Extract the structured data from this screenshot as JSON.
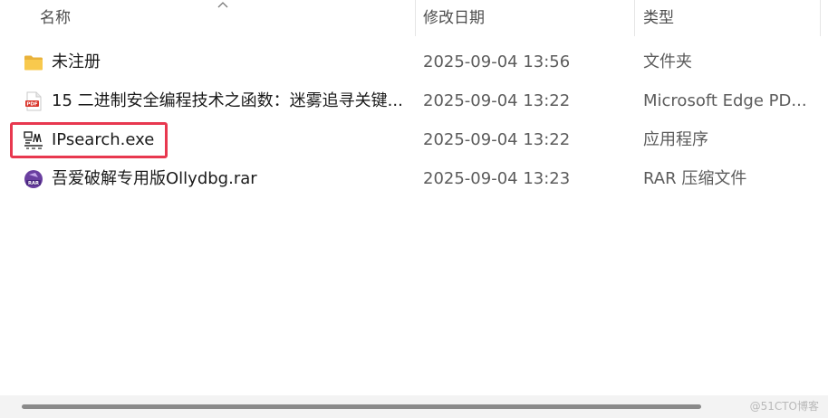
{
  "header": {
    "name_label": "名称",
    "date_label": "修改日期",
    "type_label": "类型"
  },
  "files": [
    {
      "name": "未注册",
      "date": "2025-09-04 13:56",
      "type": "文件夹",
      "icon": "folder-icon"
    },
    {
      "name": "15 二进制安全编程技术之函数：迷雾追寻关键...",
      "date": "2025-09-04 13:22",
      "type": "Microsoft Edge PD...",
      "icon": "pdf-file-icon"
    },
    {
      "name": "IPsearch.exe",
      "date": "2025-09-04 13:22",
      "type": "应用程序",
      "icon": "executable-icon"
    },
    {
      "name": "吾爱破解专用版Ollydbg.rar",
      "date": "2025-09-04 13:23",
      "type": "RAR 压缩文件",
      "icon": "rar-archive-icon"
    }
  ],
  "watermark": "@51CTO博客",
  "colors": {
    "highlight": "#e8384f",
    "folder": "#f6c548",
    "pdf": "#d9352b",
    "rar": "#6a3fa0"
  }
}
